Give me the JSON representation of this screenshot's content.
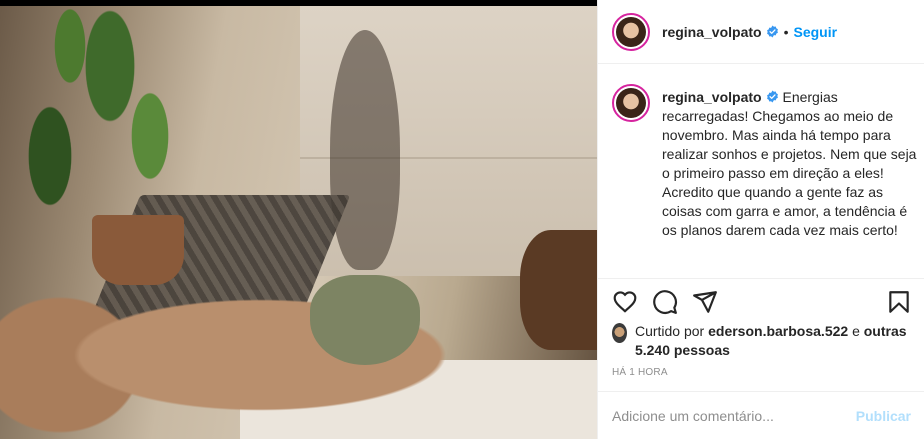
{
  "post": {
    "username": "regina_volpato",
    "follow_label": "Seguir",
    "separator": "•",
    "caption": "Energias recarregadas! Chegamos ao meio de novembro. Mas ainda há tempo para realizar sonhos e projetos. Nem que seja o primeiro passo em direção a eles! Acredito que quando a gente faz as coisas com garra e amor, a tendência é os planos darem cada vez mais certo!",
    "likes": {
      "prefix": "Curtido por",
      "liker": "ederson.barbosa.522",
      "conjunction": "e",
      "others": "outras 5.240 pessoas"
    },
    "timestamp": "HÁ 1 HORA",
    "comment_placeholder": "Adicione um comentário...",
    "post_button": "Publicar"
  },
  "colors": {
    "accent": "#0095f6",
    "post_disabled": "#b2dffc",
    "muted": "#8e8e8e",
    "text": "#262626"
  },
  "icons": [
    "verified-badge-icon",
    "heart-icon",
    "comment-icon",
    "share-icon",
    "bookmark-icon"
  ]
}
